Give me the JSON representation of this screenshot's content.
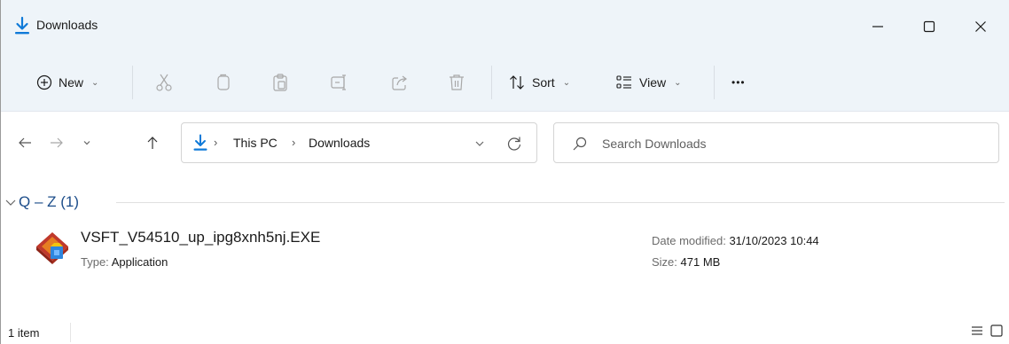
{
  "window": {
    "title": "Downloads",
    "accent": "#0f7ad8",
    "controls": {
      "minimize_icon": "minimize-icon",
      "maximize_icon": "maximize-icon",
      "close_icon": "close-icon"
    }
  },
  "commandbar": {
    "new_label": "New",
    "sort_label": "Sort",
    "view_label": "View",
    "more_label": "•••",
    "icons": [
      "plus-circle-icon",
      "cut-icon",
      "copy-icon",
      "paste-icon",
      "rename-icon",
      "share-icon",
      "delete-icon",
      "sort-arrows-icon",
      "view-list-icon"
    ]
  },
  "address": {
    "crumbs": [
      "This PC",
      "Downloads"
    ],
    "search_placeholder": "Search Downloads",
    "search_value": ""
  },
  "content": {
    "group_label": "Q – Z (1)",
    "items": [
      {
        "name": "VSFT_V54510_up_ipg8xnh5nj.EXE",
        "type_label": "Type:",
        "type_value": "Application",
        "date_label": "Date modified:",
        "date_value": "31/10/2023 10:44",
        "size_label": "Size:",
        "size_value": "471 MB"
      }
    ]
  },
  "status": {
    "count": "1 item"
  }
}
